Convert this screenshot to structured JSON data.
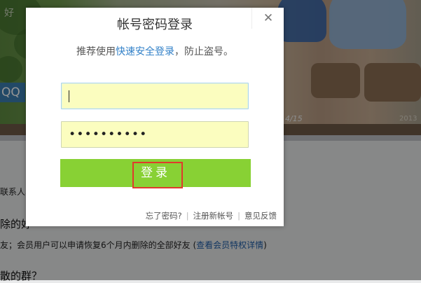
{
  "background": {
    "qq_badge": "QQ",
    "corner_text": "好",
    "pager": "4/15",
    "year": "2013",
    "text_fragment_1": "联系人、",
    "heading_fragment_1": "除的好",
    "info_line_prefix": "友；会员用户可以申请恢复6个月内删除的全部好友 (",
    "info_line_link": "查看会员特权详情",
    "info_line_suffix": ")",
    "heading_fragment_2": "散的群？"
  },
  "dialog": {
    "title": "帐号密码登录",
    "subtitle_prefix": "推荐使用",
    "subtitle_link": "快速安全登录",
    "subtitle_suffix": "，防止盗号。",
    "close_symbol": "✕",
    "username_value": "",
    "password_mask": "••••••••••",
    "login_label": "登录",
    "links": {
      "forgot_password": "忘了密码?",
      "register": "注册新帐号",
      "feedback": "意见反馈",
      "separator": "|"
    }
  },
  "colors": {
    "login_button": "#88d134",
    "input_fill": "#fbfdbf",
    "link": "#3180c8",
    "highlight_box": "#e03a2c"
  }
}
